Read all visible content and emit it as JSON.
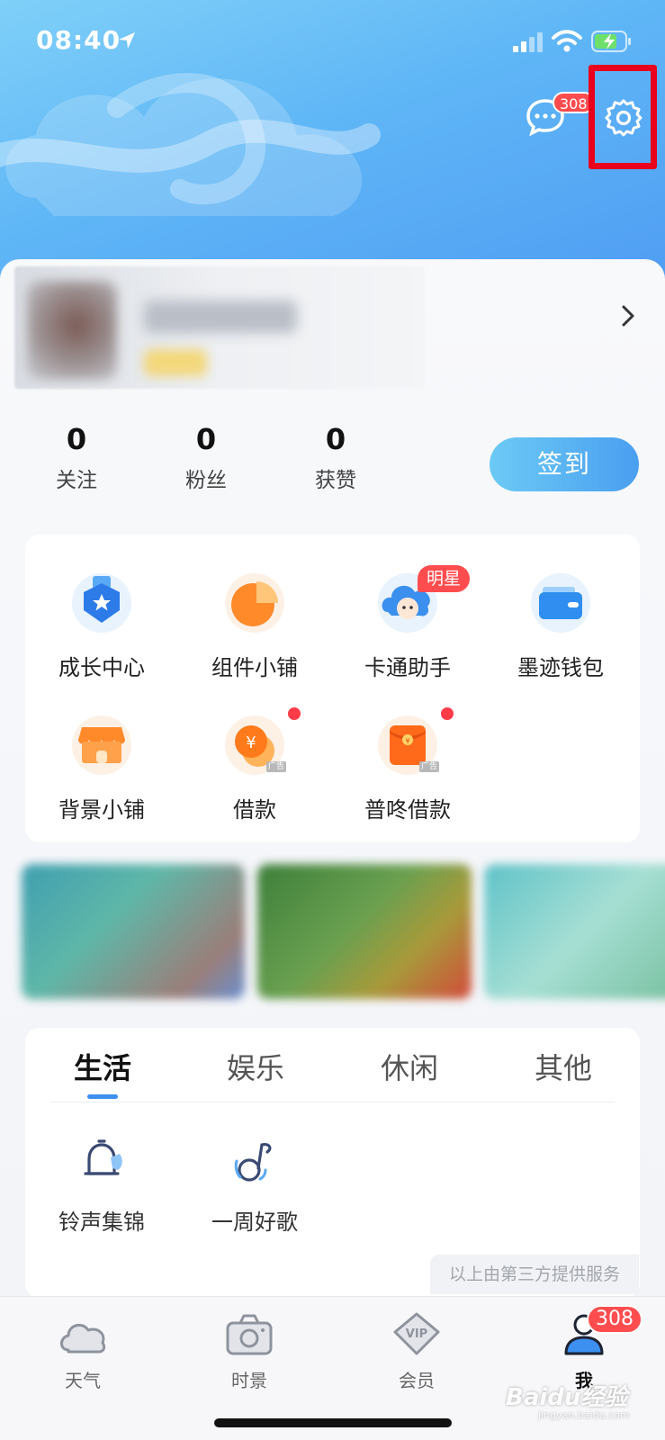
{
  "status_bar": {
    "time": "08:40"
  },
  "header": {
    "message_count": "308"
  },
  "stats": [
    {
      "value": "0",
      "label": "关注"
    },
    {
      "value": "0",
      "label": "粉丝"
    },
    {
      "value": "0",
      "label": "获赞"
    }
  ],
  "checkin_label": "签到",
  "tools": [
    {
      "label": "成长中心",
      "icon": "growth-medal-icon"
    },
    {
      "label": "组件小铺",
      "icon": "widget-pie-icon"
    },
    {
      "label": "卡通助手",
      "icon": "cartoon-assistant-icon",
      "badge": "明星"
    },
    {
      "label": "墨迹钱包",
      "icon": "wallet-icon"
    },
    {
      "label": "背景小铺",
      "icon": "background-shop-icon"
    },
    {
      "label": "借款",
      "icon": "coin-icon"
    },
    {
      "label": "普咚借款",
      "icon": "red-envelope-icon"
    }
  ],
  "ad_tag": "广告",
  "category_tabs": [
    "生活",
    "娱乐",
    "休闲",
    "其他"
  ],
  "services": [
    {
      "label": "铃声集锦",
      "icon": "bell-icon"
    },
    {
      "label": "一周好歌",
      "icon": "music-note-icon"
    }
  ],
  "provider_note": "以上由第三方提供服务",
  "bottom_nav": [
    {
      "label": "天气",
      "icon": "cloud-icon"
    },
    {
      "label": "时景",
      "icon": "camera-icon"
    },
    {
      "label": "会员",
      "icon": "vip-icon"
    },
    {
      "label": "我",
      "icon": "user-icon"
    }
  ],
  "nav_badge": "308",
  "watermark": "Baidu经验",
  "watermark_sub": "jingyan.baidu.com",
  "colors": {
    "accent": "#4a9ff0",
    "badge": "#ff4d4f",
    "highlight": "#e8001c"
  }
}
